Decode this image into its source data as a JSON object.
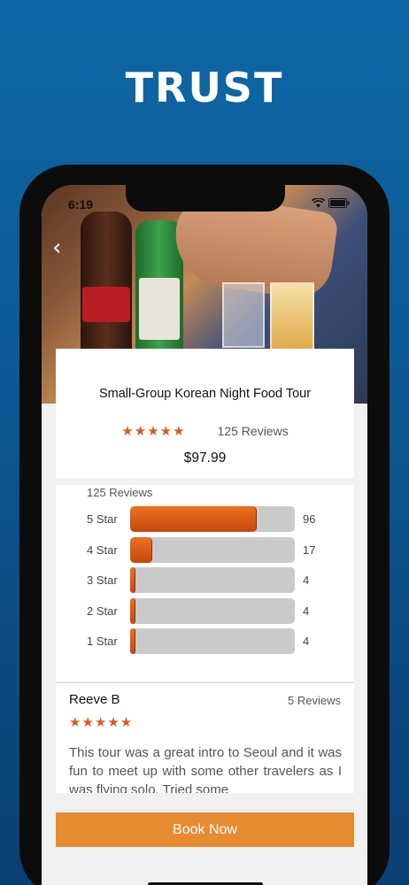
{
  "headline": "TRUST",
  "status_bar": {
    "time": "6:19"
  },
  "tour": {
    "title": "Small-Group Korean Night Food Tour",
    "rating_stars": 5,
    "rating_glyphs": "★★★★★",
    "reviews_label": "125 Reviews",
    "price": "$97.99"
  },
  "breakdown": {
    "title": "125 Reviews",
    "rows": [
      {
        "label": "5 Star",
        "count": "96",
        "fraction": 0.768
      },
      {
        "label": "4 Star",
        "count": "17",
        "fraction": 0.136
      },
      {
        "label": "3 Star",
        "count": "4",
        "fraction": 0.032
      },
      {
        "label": "2 Star",
        "count": "4",
        "fraction": 0.032
      },
      {
        "label": "1 Star",
        "count": "4",
        "fraction": 0.032
      }
    ]
  },
  "review": {
    "author": "Reeve B",
    "author_reviews": "5 Reviews",
    "stars": "★★★★★",
    "text": "This tour was a great intro to Seoul and it was fun to meet up with some other travelers as I was flying solo. Tried some"
  },
  "actions": {
    "book_label": "Book Now"
  },
  "colors": {
    "accent": "#d95a1f",
    "button": "#e88a30",
    "background": "#0d5a95"
  }
}
